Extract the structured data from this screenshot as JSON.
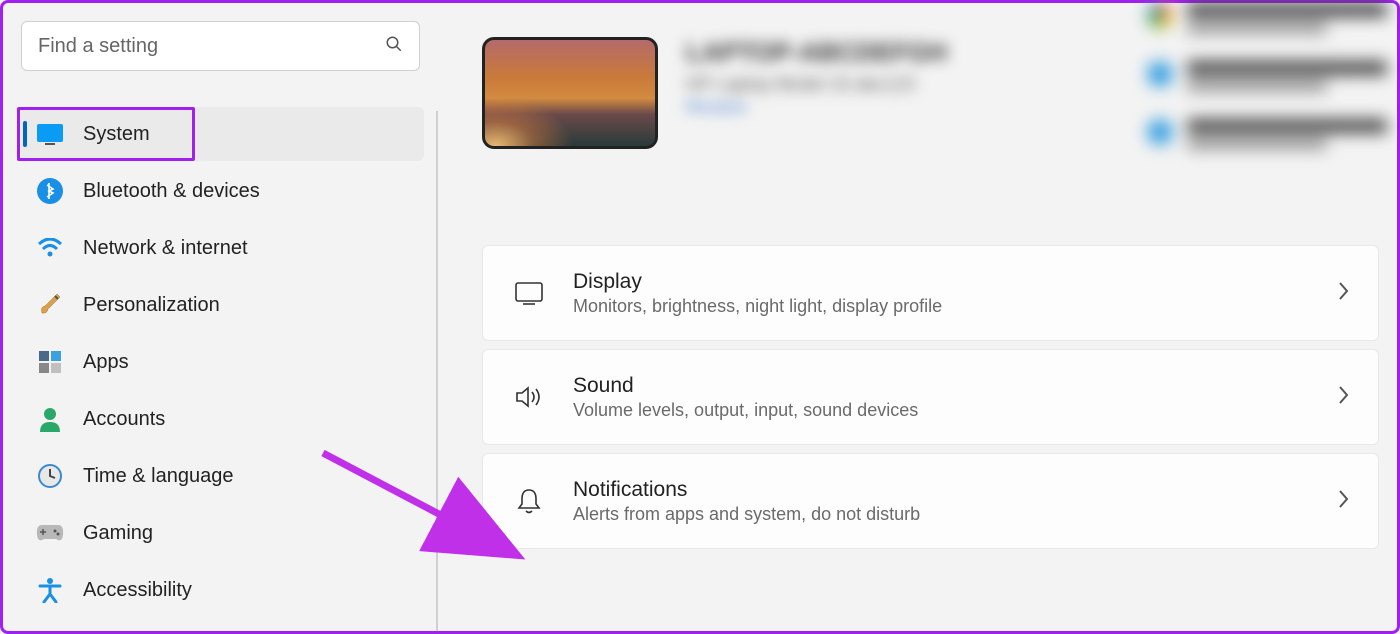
{
  "search": {
    "placeholder": "Find a setting"
  },
  "sidebar": {
    "items": [
      {
        "label": "System"
      },
      {
        "label": "Bluetooth & devices"
      },
      {
        "label": "Network & internet"
      },
      {
        "label": "Personalization"
      },
      {
        "label": "Apps"
      },
      {
        "label": "Accounts"
      },
      {
        "label": "Time & language"
      },
      {
        "label": "Gaming"
      },
      {
        "label": "Accessibility"
      }
    ]
  },
  "settings": [
    {
      "title": "Display",
      "subtitle": "Monitors, brightness, night light, display profile"
    },
    {
      "title": "Sound",
      "subtitle": "Volume levels, output, input, sound devices"
    },
    {
      "title": "Notifications",
      "subtitle": "Alerts from apps and system, do not disturb"
    }
  ]
}
